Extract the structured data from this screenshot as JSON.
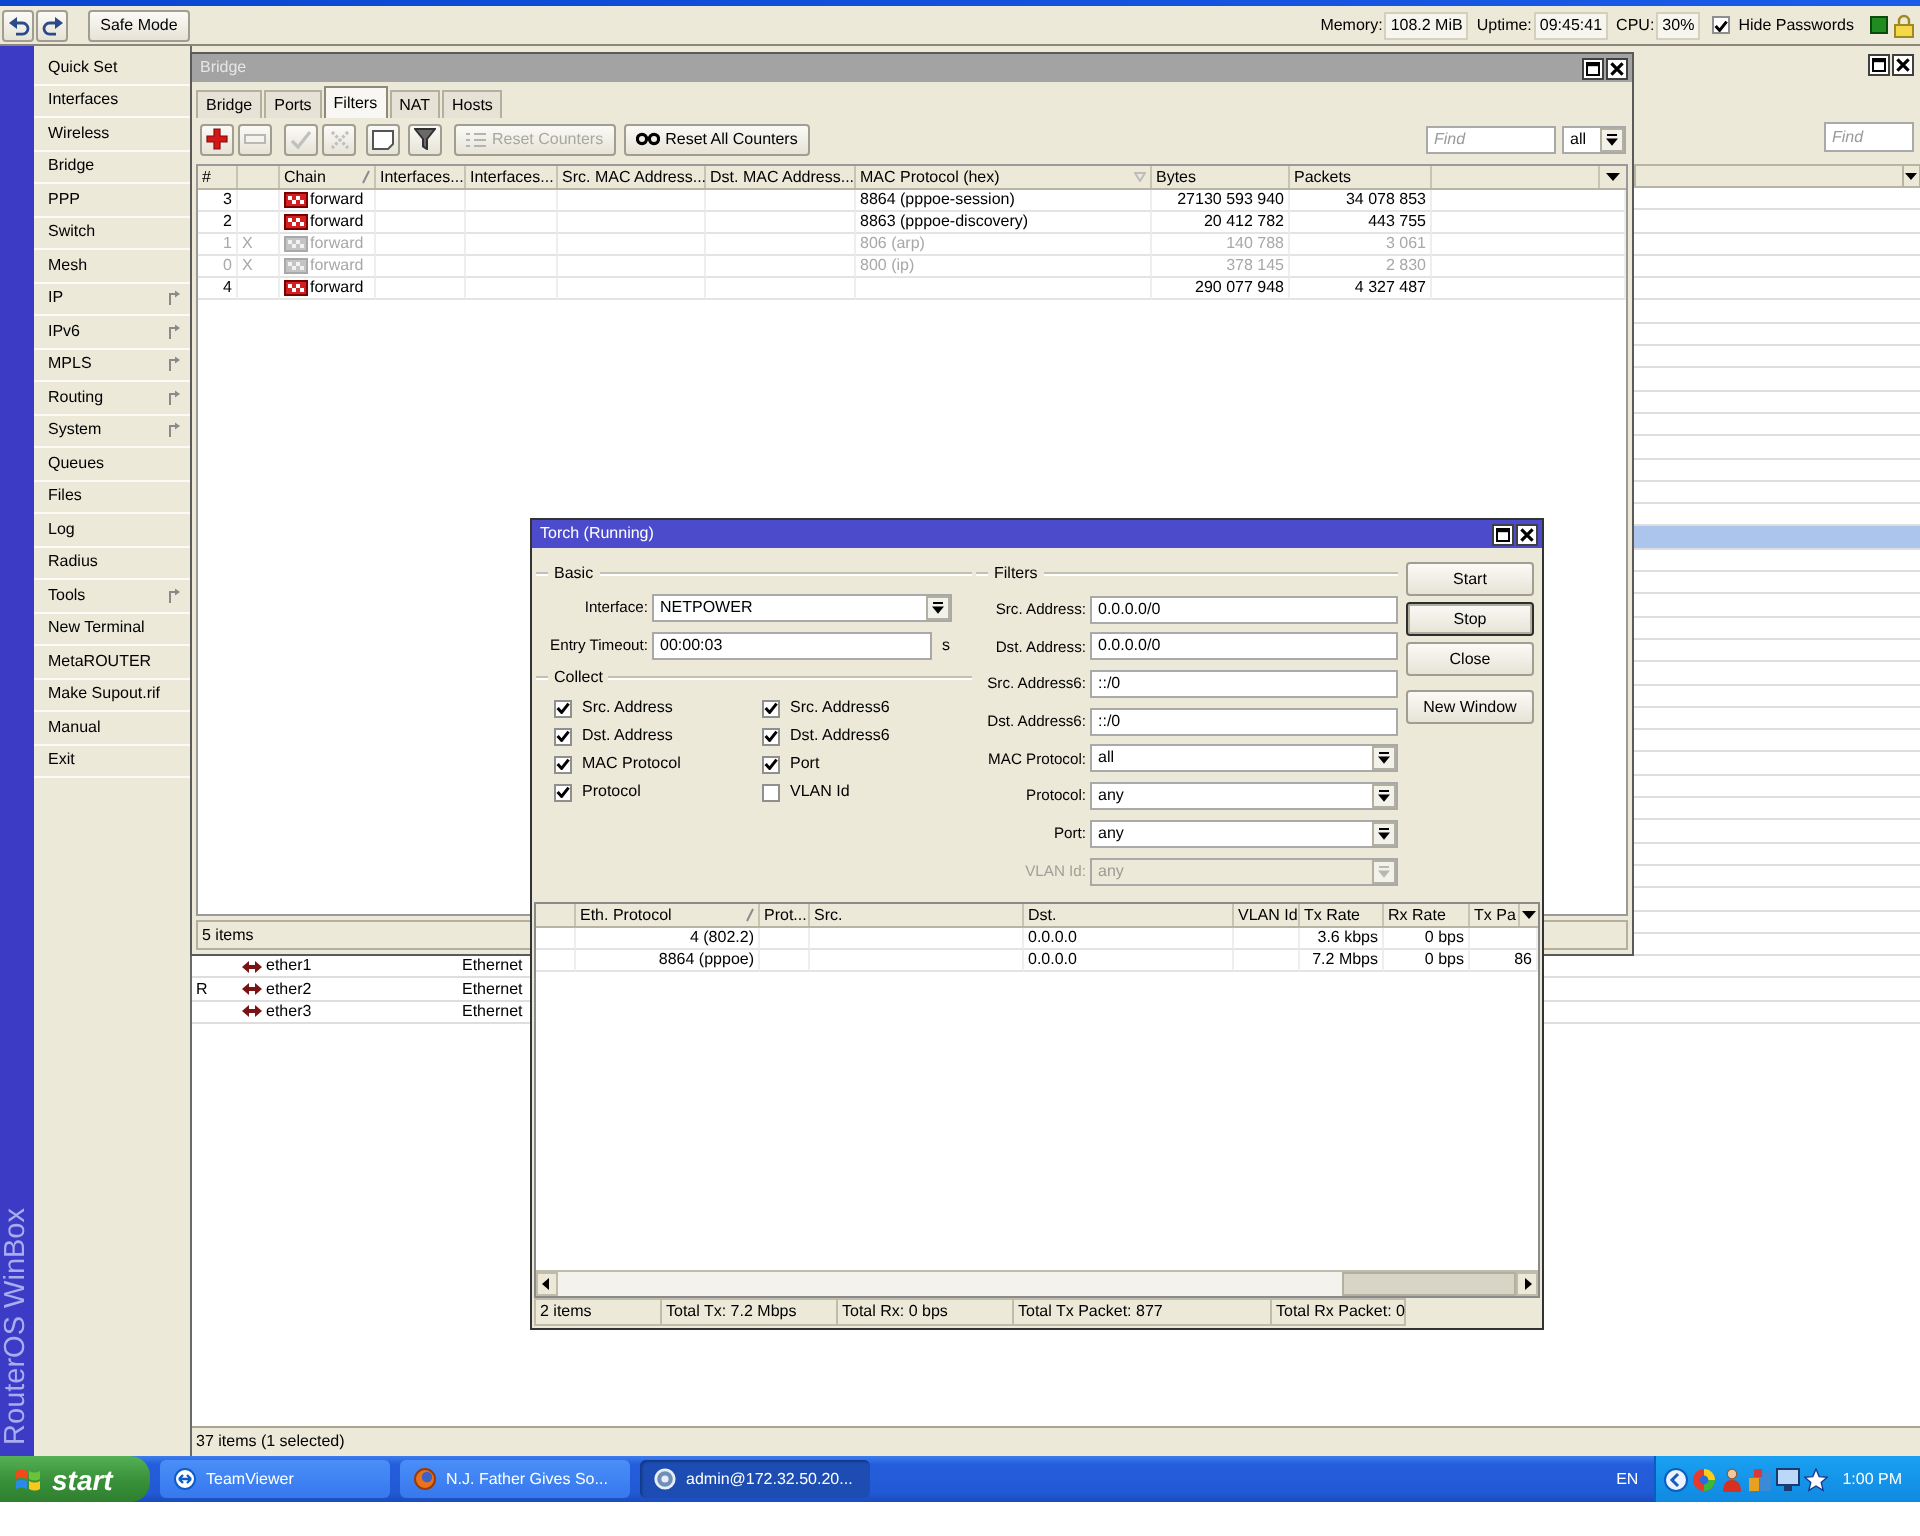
{
  "top_toolbar": {
    "buttons": [
      {
        "kind": "undo"
      },
      {
        "kind": "redo"
      }
    ],
    "safe_mode": "Safe Mode",
    "status": [
      {
        "label": "Memory:",
        "value": "108.2 MiB"
      },
      {
        "label": "Uptime:",
        "value": "09:45:41"
      },
      {
        "label": "CPU:",
        "value": "30%"
      }
    ],
    "hide_passwords": {
      "label": "Hide Passwords",
      "checked": true
    }
  },
  "brand": "RouterOS WinBox",
  "sidebar": {
    "items": [
      {
        "label": "Quick Set",
        "submenu": false
      },
      {
        "label": "Interfaces",
        "submenu": false
      },
      {
        "label": "Wireless",
        "submenu": false
      },
      {
        "label": "Bridge",
        "submenu": false
      },
      {
        "label": "PPP",
        "submenu": false
      },
      {
        "label": "Switch",
        "submenu": false
      },
      {
        "label": "Mesh",
        "submenu": false
      },
      {
        "label": "IP",
        "submenu": true
      },
      {
        "label": "IPv6",
        "submenu": true
      },
      {
        "label": "MPLS",
        "submenu": true
      },
      {
        "label": "Routing",
        "submenu": true
      },
      {
        "label": "System",
        "submenu": true
      },
      {
        "label": "Queues",
        "submenu": false
      },
      {
        "label": "Files",
        "submenu": false
      },
      {
        "label": "Log",
        "submenu": false
      },
      {
        "label": "Radius",
        "submenu": false
      },
      {
        "label": "Tools",
        "submenu": true
      },
      {
        "label": "New Terminal",
        "submenu": false
      },
      {
        "label": "MetaROUTER",
        "submenu": false
      },
      {
        "label": "Make Supout.rif",
        "submenu": false
      },
      {
        "label": "Manual",
        "submenu": false
      },
      {
        "label": "Exit",
        "submenu": false
      }
    ]
  },
  "interfaces_window": {
    "find_placeholder": "Find",
    "rows": [
      {
        "selected": false
      },
      {
        "selected": false
      },
      {
        "selected": false
      },
      {
        "selected": false
      },
      {
        "selected": false
      },
      {
        "selected": false
      },
      {
        "selected": false
      },
      {
        "selected": false
      },
      {
        "selected": false
      },
      {
        "selected": false
      },
      {
        "selected": false
      },
      {
        "selected": false
      },
      {
        "selected": false
      },
      {
        "selected": false
      },
      {
        "selected": false
      },
      {
        "selected": true
      },
      {
        "selected": false
      },
      {
        "selected": false
      },
      {
        "selected": false
      },
      {
        "selected": false
      },
      {
        "selected": false
      },
      {
        "selected": false
      },
      {
        "selected": false
      },
      {
        "selected": false
      },
      {
        "selected": false
      },
      {
        "selected": false
      },
      {
        "selected": false
      },
      {
        "selected": false
      },
      {
        "selected": false
      },
      {
        "selected": false
      },
      {
        "selected": false
      },
      {
        "selected": false
      },
      {
        "selected": false
      },
      {
        "selected": false
      },
      {
        "name": "ether1",
        "type": "Ethernet",
        "selected": false
      },
      {
        "flag": "R",
        "name": "ether2",
        "type": "Ethernet",
        "selected": false
      },
      {
        "name": "ether3",
        "type": "Ethernet",
        "selected": false
      }
    ],
    "status": "37 items (1 selected)"
  },
  "bridge_window": {
    "title": "Bridge",
    "tabs": [
      {
        "label": "Bridge",
        "selected": false
      },
      {
        "label": "Ports",
        "selected": false
      },
      {
        "label": "Filters",
        "selected": true
      },
      {
        "label": "NAT",
        "selected": false
      },
      {
        "label": "Hosts",
        "selected": false
      }
    ],
    "toolbar": [
      {
        "kind": "add",
        "disabled": false
      },
      {
        "kind": "remove",
        "disabled": true
      },
      {
        "kind": "enable",
        "disabled": true
      },
      {
        "kind": "disable",
        "disabled": true
      },
      {
        "kind": "comment",
        "disabled": false
      },
      {
        "kind": "filter",
        "disabled": false
      },
      {
        "kind": "reset_counters",
        "label": "Reset Counters",
        "disabled": true
      },
      {
        "kind": "reset_all_counters",
        "label": "Reset All Counters",
        "disabled": false
      }
    ],
    "find_placeholder": "Find",
    "filter_select": "all",
    "columns": [
      {
        "label": "#",
        "sorted": false
      },
      {
        "label": "Chain",
        "sorted": true,
        "descending": false
      },
      {
        "label": "Interfaces...",
        "sorted": false
      },
      {
        "label": "Interfaces...",
        "sorted": false
      },
      {
        "label": "Src. MAC Address...",
        "sorted": false
      },
      {
        "label": "Dst. MAC Address...",
        "sorted": false
      },
      {
        "label": "MAC Protocol (hex)",
        "sorted": true,
        "descending": true
      },
      {
        "label": "Bytes",
        "sorted": false
      },
      {
        "label": "Packets",
        "sorted": false
      }
    ],
    "rows": [
      {
        "number": "3",
        "chain": "forward",
        "mac_protocol": "8864 (pppoe-session)",
        "bytes": "27130 593 940",
        "packets": "34 078 853",
        "disabled": false,
        "selected": false
      },
      {
        "number": "2",
        "chain": "forward",
        "mac_protocol": "8863 (pppoe-discovery)",
        "bytes": "20 412 782",
        "packets": "443 755",
        "disabled": false,
        "selected": false
      },
      {
        "number": "1",
        "flag": "X",
        "chain": "forward",
        "mac_protocol": "806 (arp)",
        "bytes": "140 788",
        "packets": "3 061",
        "disabled": true,
        "selected": false
      },
      {
        "number": "0",
        "flag": "X",
        "chain": "forward",
        "mac_protocol": "800 (ip)",
        "bytes": "378 145",
        "packets": "2 830",
        "disabled": true,
        "selected": false
      },
      {
        "number": "4",
        "chain": "forward",
        "bytes": "290 077 948",
        "packets": "4 327 487",
        "disabled": false,
        "selected": false
      }
    ],
    "status": "5 items"
  },
  "torch_window": {
    "title": "Torch (Running)",
    "basic": {
      "legend": "Basic",
      "interface": {
        "label": "Interface:",
        "value": "NETPOWER"
      },
      "entry_timeout": {
        "label": "Entry Timeout:",
        "value": "00:00:03",
        "unit": "s"
      }
    },
    "collect": {
      "legend": "Collect",
      "options": [
        {
          "label": "Src. Address",
          "checked": true
        },
        {
          "label": "Src. Address6",
          "checked": true
        },
        {
          "label": "Dst. Address",
          "checked": true
        },
        {
          "label": "Dst. Address6",
          "checked": true
        },
        {
          "label": "MAC Protocol",
          "checked": true
        },
        {
          "label": "Port",
          "checked": true
        },
        {
          "label": "Protocol",
          "checked": true
        },
        {
          "label": "VLAN Id",
          "checked": false
        }
      ]
    },
    "filters": {
      "legend": "Filters",
      "fields": [
        {
          "label": "Src. Address:",
          "value": "0.0.0.0/0",
          "kind": "text",
          "disabled": false
        },
        {
          "label": "Dst. Address:",
          "value": "0.0.0.0/0",
          "kind": "text",
          "disabled": false
        },
        {
          "label": "Src. Address6:",
          "value": "::/0",
          "kind": "text",
          "disabled": false
        },
        {
          "label": "Dst. Address6:",
          "value": "::/0",
          "kind": "text",
          "disabled": false
        },
        {
          "label": "MAC Protocol:",
          "value": "all",
          "kind": "select",
          "disabled": false
        },
        {
          "label": "Protocol:",
          "value": "any",
          "kind": "select",
          "disabled": false
        },
        {
          "label": "Port:",
          "value": "any",
          "kind": "select",
          "disabled": false
        },
        {
          "label": "VLAN Id:",
          "value": "any",
          "kind": "select",
          "disabled": true
        }
      ]
    },
    "buttons": [
      {
        "label": "Start",
        "default": false
      },
      {
        "label": "Stop",
        "default": true
      },
      {
        "label": "Close",
        "default": false
      },
      {
        "label": "New Window",
        "default": false
      }
    ],
    "columns": [
      {
        "label": "Eth. Protocol",
        "sorted": true,
        "descending": false
      },
      {
        "label": "Prot...",
        "sorted": false
      },
      {
        "label": "Src.",
        "sorted": false
      },
      {
        "label": "Dst.",
        "sorted": false
      },
      {
        "label": "VLAN Id",
        "sorted": false
      },
      {
        "label": "Tx Rate",
        "sorted": false
      },
      {
        "label": "Rx Rate",
        "sorted": false
      },
      {
        "label": "Tx Pa",
        "sorted": false
      }
    ],
    "rows": [
      {
        "eth_protocol": "4 (802.2)",
        "dst": "0.0.0.0",
        "tx_rate": "3.6 kbps",
        "rx_rate": "0 bps",
        "selected": false
      },
      {
        "eth_protocol": "8864 (pppoe)",
        "dst": "0.0.0.0",
        "tx_rate": "7.2 Mbps",
        "rx_rate": "0 bps",
        "tx_pa": "86",
        "selected": false
      }
    ],
    "status": [
      "2 items",
      "Total Tx: 7.2 Mbps",
      "Total Rx: 0 bps",
      "Total Tx Packet: 877",
      "Total Rx Packet: 0"
    ]
  },
  "taskbar": {
    "start": "start",
    "tasks": [
      {
        "label": "TeamViewer",
        "kind": "remote_control",
        "selected": false
      },
      {
        "label": "N.J. Father Gives So...",
        "kind": "browser",
        "selected": false
      },
      {
        "label": "admin@172.32.50.20...",
        "kind": "router_admin",
        "selected": true
      }
    ],
    "language": "EN",
    "clock": "1:00 PM"
  }
}
